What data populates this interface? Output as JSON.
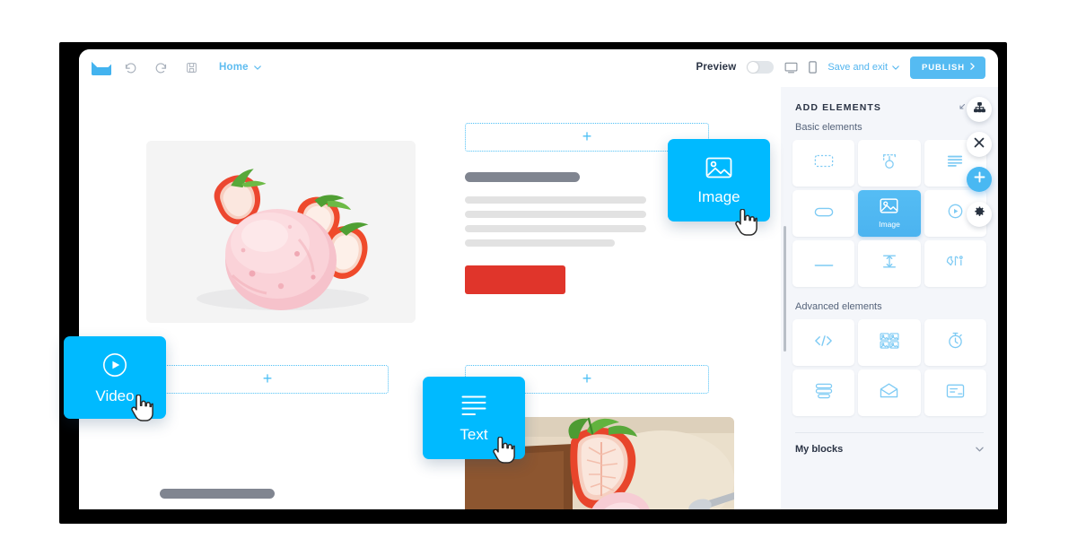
{
  "app": {
    "logo_icon": "envelope-logo-icon",
    "toolbar": {
      "undo_icon": "undo-icon",
      "redo_icon": "redo-icon",
      "save_icon": "save-disk-icon",
      "page_name": "Home",
      "page_chevron_icon": "chevron-down-icon",
      "preview_label": "Preview",
      "preview_toggle_state": "off",
      "desktop_icon": "desktop-monitor-icon",
      "mobile_icon": "mobile-phone-icon",
      "save_and_exit_label": "Save and exit",
      "save_and_exit_chevron_icon": "chevron-down-icon",
      "publish_label": "PUBLISH",
      "publish_arrow_icon": "chevron-right-icon"
    }
  },
  "panel": {
    "title": "ADD ELEMENTS",
    "collapse_icon": "collapse-arrow-icon",
    "close_icon": "close-x-icon",
    "basic_label": "Basic elements",
    "basic_items": [
      {
        "icon": "container-dashed-icon",
        "label": "",
        "selected": false
      },
      {
        "icon": "structure-node-icon",
        "label": "",
        "selected": false
      },
      {
        "icon": "text-lines-icon",
        "label": "",
        "selected": false
      },
      {
        "icon": "button-pill-icon",
        "label": "",
        "selected": false
      },
      {
        "icon": "image-icon",
        "label": "Image",
        "selected": true
      },
      {
        "icon": "video-play-icon",
        "label": "",
        "selected": false
      },
      {
        "icon": "divider-line-icon",
        "label": "",
        "selected": false
      },
      {
        "icon": "spacer-icon",
        "label": "",
        "selected": false
      },
      {
        "icon": "social-icons-icon",
        "label": "",
        "selected": false
      }
    ],
    "advanced_label": "Advanced elements",
    "advanced_items": [
      {
        "icon": "html-code-icon",
        "label": ""
      },
      {
        "icon": "gallery-grid-icon",
        "label": ""
      },
      {
        "icon": "timer-icon",
        "label": ""
      },
      {
        "icon": "menu-stack-icon",
        "label": ""
      },
      {
        "icon": "envelope-open-icon",
        "label": ""
      },
      {
        "icon": "card-form-icon",
        "label": ""
      }
    ],
    "my_blocks_label": "My blocks",
    "my_blocks_chevron_icon": "chevron-down-icon"
  },
  "fabs": [
    {
      "icon": "sitemap-icon",
      "style": "white"
    },
    {
      "icon": "close-x-icon",
      "style": "white"
    },
    {
      "icon": "plus-icon",
      "style": "blue"
    },
    {
      "icon": "gear-icon",
      "style": "white"
    }
  ],
  "canvas": {
    "drop_zone_plus": "+",
    "drop_zones": [
      {
        "name": "drop-zone-top-right"
      },
      {
        "name": "drop-zone-bottom-left"
      },
      {
        "name": "drop-zone-bottom-right"
      }
    ],
    "photo_top_alt": "strawberry-ice-cream-scoop-photo",
    "photo_bottom_alt": "sliced-strawberry-dessert-photo",
    "cta_color": "#e0352b",
    "heading_placeholder_color": "#808590",
    "body_placeholder_color": "#e2e2e2"
  },
  "drag_cards": [
    {
      "label": "Image",
      "icon": "image-icon",
      "cursor": "pointer-hand-cursor"
    },
    {
      "label": "Video",
      "icon": "video-play-icon",
      "cursor": "pointer-hand-cursor"
    },
    {
      "label": "Text",
      "icon": "text-lines-icon",
      "cursor": "pointer-hand-cursor"
    }
  ],
  "colors": {
    "accent_blue": "#00baff",
    "panel_blue": "#55bdf4",
    "link_blue": "#52b5ef",
    "cta_red": "#e0352b",
    "panel_bg": "#f4f6fa"
  }
}
